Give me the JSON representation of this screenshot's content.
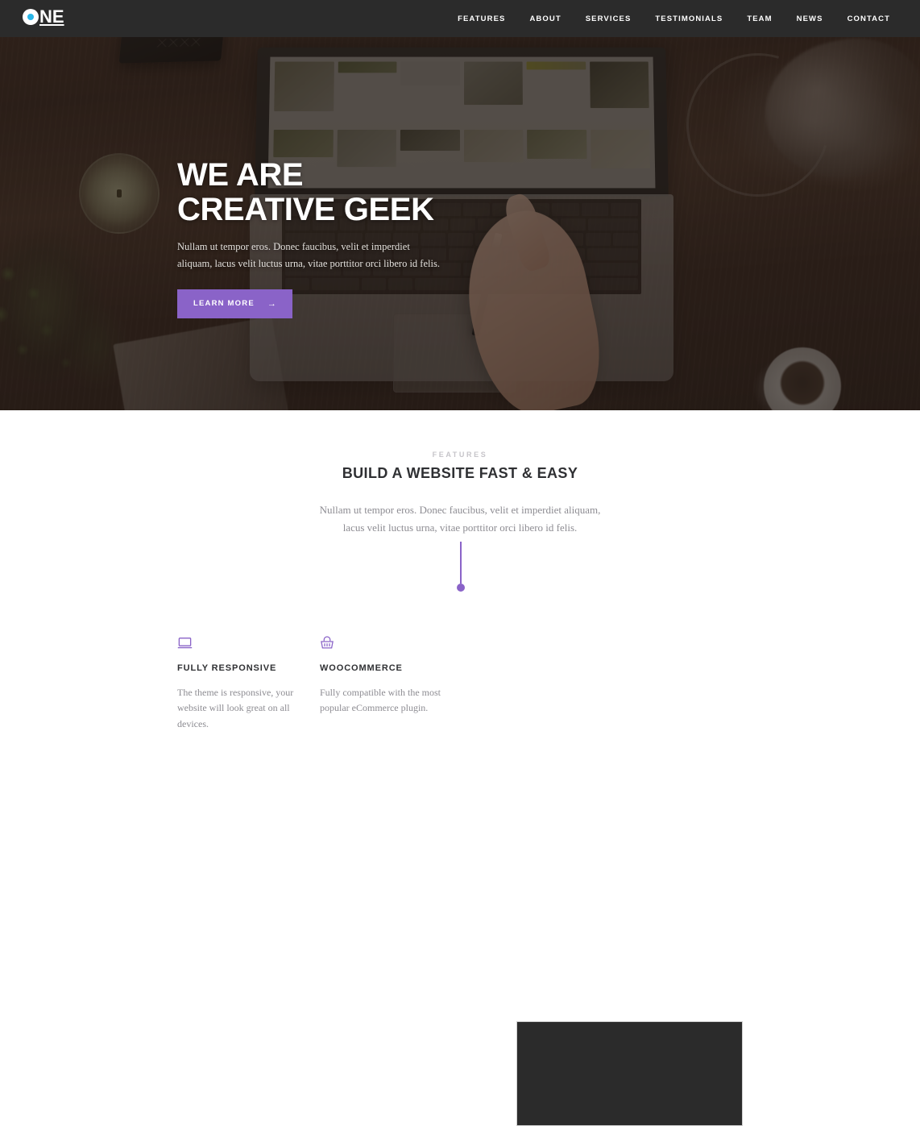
{
  "header": {
    "logo": {
      "first_letter": "O",
      "rest": "NE",
      "dot_color": "#29b6e8"
    },
    "nav": [
      {
        "label": "FEATURES",
        "name": "nav-features"
      },
      {
        "label": "ABOUT",
        "name": "nav-about"
      },
      {
        "label": "SERVICES",
        "name": "nav-services"
      },
      {
        "label": "TESTIMONIALS",
        "name": "nav-testimonials"
      },
      {
        "label": "TEAM",
        "name": "nav-team"
      },
      {
        "label": "NEWS",
        "name": "nav-news"
      },
      {
        "label": "CONTACT",
        "name": "nav-contact"
      }
    ],
    "background_color": "#2b2b2b"
  },
  "hero": {
    "title_line1": "WE ARE",
    "title_line2": "CREATIVE GEEK",
    "subtitle": "Nullam ut tempor eros. Donec faucibus, velit et imperdiet aliquam, lacus velit luctus urna, vitae porttitor orci libero id felis.",
    "button_label": "LEARN MORE",
    "button_arrow": "→",
    "button_color": "#8a63c8",
    "background_description": "dark wooden desk with laptop, hand holding pen, candle, plant, speaker and lamp"
  },
  "features": {
    "eyebrow": "FEATURES",
    "title": "BUILD A WEBSITE FAST & EASY",
    "description": "Nullam ut tempor eros. Donec faucibus, velit et imperdiet aliquam, lacus velit luctus urna, vitae porttitor orci libero id felis.",
    "accent_color": "#8a63c8",
    "items": [
      {
        "icon": "laptop-icon",
        "name": "FULLY RESPONSIVE",
        "text": "The theme is responsive, your website will look great on all devices."
      },
      {
        "icon": "shopping-basket-icon",
        "name": "WOOCOMMERCE",
        "text": "Fully compatible with the most popular eCommerce plugin."
      }
    ]
  },
  "media": {
    "placeholder_color": "#2b2b2b"
  }
}
